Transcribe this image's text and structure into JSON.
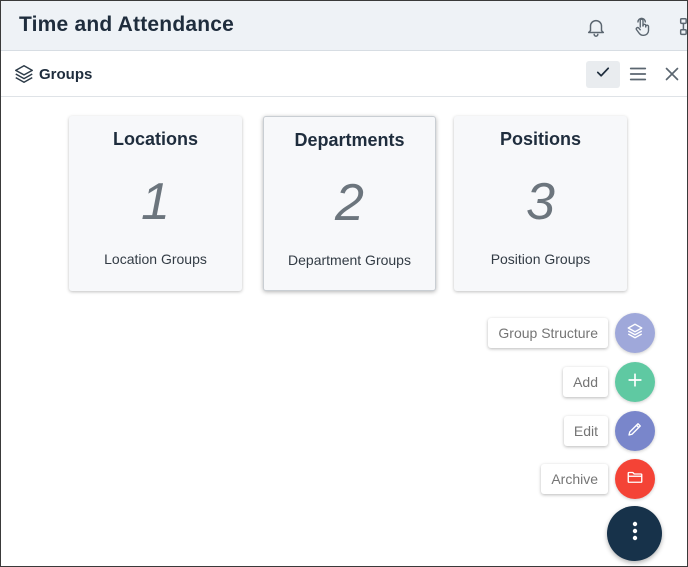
{
  "app": {
    "title": "Time and Attendance"
  },
  "header_icons": [
    "bell-icon",
    "touch-icon",
    "org-icon"
  ],
  "toolbar": {
    "title": "Groups",
    "icon": "layers-icon"
  },
  "cards": [
    {
      "title": "Locations",
      "count": "1",
      "subtitle": "Location Groups"
    },
    {
      "title": "Departments",
      "count": "2",
      "subtitle": "Department Groups"
    },
    {
      "title": "Positions",
      "count": "3",
      "subtitle": "Position Groups"
    }
  ],
  "fab_actions": [
    {
      "label": "Group Structure",
      "icon": "layers-icon",
      "color": "#9fa8da"
    },
    {
      "label": "Add",
      "icon": "plus-icon",
      "color": "#5fc9a2"
    },
    {
      "label": "Edit",
      "icon": "pencil-icon",
      "color": "#7986cb"
    },
    {
      "label": "Archive",
      "icon": "folder-icon",
      "color": "#f44336"
    }
  ],
  "fab_main": {
    "icon": "more-vertical-icon",
    "color": "#17324a"
  }
}
